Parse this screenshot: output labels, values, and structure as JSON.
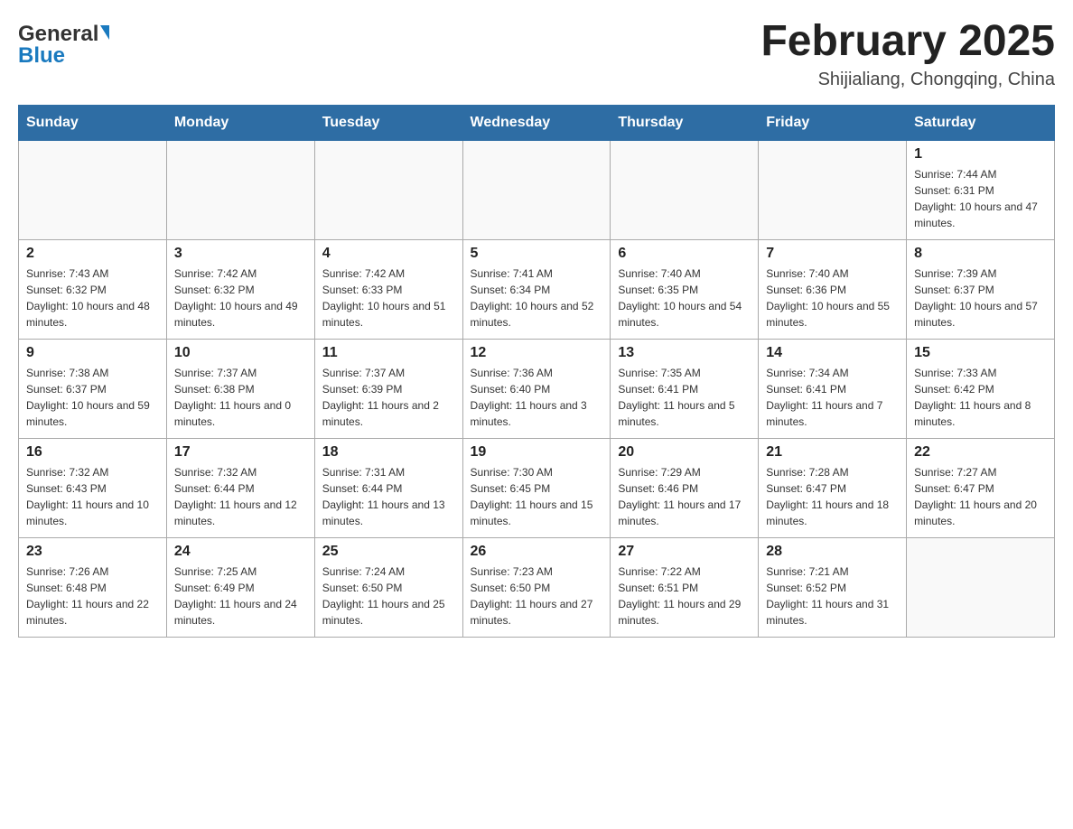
{
  "header": {
    "title": "February 2025",
    "subtitle": "Shijialiang, Chongqing, China",
    "logo_general": "General",
    "logo_blue": "Blue"
  },
  "weekdays": [
    "Sunday",
    "Monday",
    "Tuesday",
    "Wednesday",
    "Thursday",
    "Friday",
    "Saturday"
  ],
  "weeks": [
    [
      {
        "day": "",
        "sunrise": "",
        "sunset": "",
        "daylight": ""
      },
      {
        "day": "",
        "sunrise": "",
        "sunset": "",
        "daylight": ""
      },
      {
        "day": "",
        "sunrise": "",
        "sunset": "",
        "daylight": ""
      },
      {
        "day": "",
        "sunrise": "",
        "sunset": "",
        "daylight": ""
      },
      {
        "day": "",
        "sunrise": "",
        "sunset": "",
        "daylight": ""
      },
      {
        "day": "",
        "sunrise": "",
        "sunset": "",
        "daylight": ""
      },
      {
        "day": "1",
        "sunrise": "Sunrise: 7:44 AM",
        "sunset": "Sunset: 6:31 PM",
        "daylight": "Daylight: 10 hours and 47 minutes."
      }
    ],
    [
      {
        "day": "2",
        "sunrise": "Sunrise: 7:43 AM",
        "sunset": "Sunset: 6:32 PM",
        "daylight": "Daylight: 10 hours and 48 minutes."
      },
      {
        "day": "3",
        "sunrise": "Sunrise: 7:42 AM",
        "sunset": "Sunset: 6:32 PM",
        "daylight": "Daylight: 10 hours and 49 minutes."
      },
      {
        "day": "4",
        "sunrise": "Sunrise: 7:42 AM",
        "sunset": "Sunset: 6:33 PM",
        "daylight": "Daylight: 10 hours and 51 minutes."
      },
      {
        "day": "5",
        "sunrise": "Sunrise: 7:41 AM",
        "sunset": "Sunset: 6:34 PM",
        "daylight": "Daylight: 10 hours and 52 minutes."
      },
      {
        "day": "6",
        "sunrise": "Sunrise: 7:40 AM",
        "sunset": "Sunset: 6:35 PM",
        "daylight": "Daylight: 10 hours and 54 minutes."
      },
      {
        "day": "7",
        "sunrise": "Sunrise: 7:40 AM",
        "sunset": "Sunset: 6:36 PM",
        "daylight": "Daylight: 10 hours and 55 minutes."
      },
      {
        "day": "8",
        "sunrise": "Sunrise: 7:39 AM",
        "sunset": "Sunset: 6:37 PM",
        "daylight": "Daylight: 10 hours and 57 minutes."
      }
    ],
    [
      {
        "day": "9",
        "sunrise": "Sunrise: 7:38 AM",
        "sunset": "Sunset: 6:37 PM",
        "daylight": "Daylight: 10 hours and 59 minutes."
      },
      {
        "day": "10",
        "sunrise": "Sunrise: 7:37 AM",
        "sunset": "Sunset: 6:38 PM",
        "daylight": "Daylight: 11 hours and 0 minutes."
      },
      {
        "day": "11",
        "sunrise": "Sunrise: 7:37 AM",
        "sunset": "Sunset: 6:39 PM",
        "daylight": "Daylight: 11 hours and 2 minutes."
      },
      {
        "day": "12",
        "sunrise": "Sunrise: 7:36 AM",
        "sunset": "Sunset: 6:40 PM",
        "daylight": "Daylight: 11 hours and 3 minutes."
      },
      {
        "day": "13",
        "sunrise": "Sunrise: 7:35 AM",
        "sunset": "Sunset: 6:41 PM",
        "daylight": "Daylight: 11 hours and 5 minutes."
      },
      {
        "day": "14",
        "sunrise": "Sunrise: 7:34 AM",
        "sunset": "Sunset: 6:41 PM",
        "daylight": "Daylight: 11 hours and 7 minutes."
      },
      {
        "day": "15",
        "sunrise": "Sunrise: 7:33 AM",
        "sunset": "Sunset: 6:42 PM",
        "daylight": "Daylight: 11 hours and 8 minutes."
      }
    ],
    [
      {
        "day": "16",
        "sunrise": "Sunrise: 7:32 AM",
        "sunset": "Sunset: 6:43 PM",
        "daylight": "Daylight: 11 hours and 10 minutes."
      },
      {
        "day": "17",
        "sunrise": "Sunrise: 7:32 AM",
        "sunset": "Sunset: 6:44 PM",
        "daylight": "Daylight: 11 hours and 12 minutes."
      },
      {
        "day": "18",
        "sunrise": "Sunrise: 7:31 AM",
        "sunset": "Sunset: 6:44 PM",
        "daylight": "Daylight: 11 hours and 13 minutes."
      },
      {
        "day": "19",
        "sunrise": "Sunrise: 7:30 AM",
        "sunset": "Sunset: 6:45 PM",
        "daylight": "Daylight: 11 hours and 15 minutes."
      },
      {
        "day": "20",
        "sunrise": "Sunrise: 7:29 AM",
        "sunset": "Sunset: 6:46 PM",
        "daylight": "Daylight: 11 hours and 17 minutes."
      },
      {
        "day": "21",
        "sunrise": "Sunrise: 7:28 AM",
        "sunset": "Sunset: 6:47 PM",
        "daylight": "Daylight: 11 hours and 18 minutes."
      },
      {
        "day": "22",
        "sunrise": "Sunrise: 7:27 AM",
        "sunset": "Sunset: 6:47 PM",
        "daylight": "Daylight: 11 hours and 20 minutes."
      }
    ],
    [
      {
        "day": "23",
        "sunrise": "Sunrise: 7:26 AM",
        "sunset": "Sunset: 6:48 PM",
        "daylight": "Daylight: 11 hours and 22 minutes."
      },
      {
        "day": "24",
        "sunrise": "Sunrise: 7:25 AM",
        "sunset": "Sunset: 6:49 PM",
        "daylight": "Daylight: 11 hours and 24 minutes."
      },
      {
        "day": "25",
        "sunrise": "Sunrise: 7:24 AM",
        "sunset": "Sunset: 6:50 PM",
        "daylight": "Daylight: 11 hours and 25 minutes."
      },
      {
        "day": "26",
        "sunrise": "Sunrise: 7:23 AM",
        "sunset": "Sunset: 6:50 PM",
        "daylight": "Daylight: 11 hours and 27 minutes."
      },
      {
        "day": "27",
        "sunrise": "Sunrise: 7:22 AM",
        "sunset": "Sunset: 6:51 PM",
        "daylight": "Daylight: 11 hours and 29 minutes."
      },
      {
        "day": "28",
        "sunrise": "Sunrise: 7:21 AM",
        "sunset": "Sunset: 6:52 PM",
        "daylight": "Daylight: 11 hours and 31 minutes."
      },
      {
        "day": "",
        "sunrise": "",
        "sunset": "",
        "daylight": ""
      }
    ]
  ]
}
